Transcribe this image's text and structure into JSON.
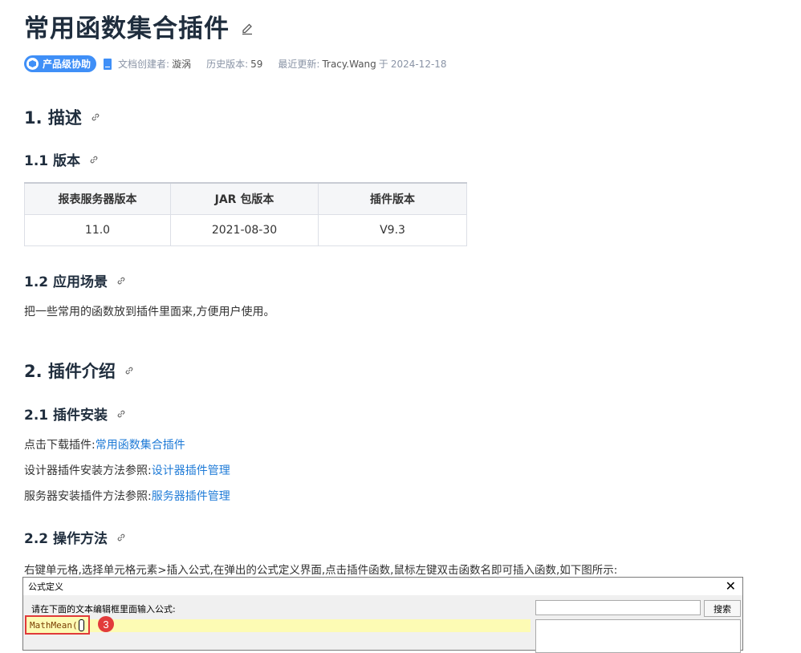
{
  "page": {
    "title": "常用函数集合插件"
  },
  "meta": {
    "badge": "产品级协助",
    "creator_label": "文档创建者:",
    "creator": "漩涡",
    "version_label": "历史版本:",
    "version": "59",
    "updated_label": "最近更新:",
    "updated_by": "Tracy.Wang",
    "updated_on_word": "于",
    "updated_date": "2024-12-18"
  },
  "sections": {
    "s1": "1. 描述",
    "s1_1": "1.1 版本",
    "s1_2": "1.2 应用场景",
    "s2": "2. 插件介绍",
    "s2_1": "2.1 插件安装",
    "s2_2": "2.2 操作方法"
  },
  "version_table": {
    "headers": [
      "报表服务器版本",
      "JAR 包版本",
      "插件版本"
    ],
    "row": [
      "11.0",
      "2021-08-30",
      "V9.3"
    ]
  },
  "scenario_text": "把一些常用的函数放到插件里面来,方便用户使用。",
  "install": {
    "download_prefix": "点击下载插件:",
    "download_link": "常用函数集合插件",
    "designer_prefix": "设计器插件安装方法参照:",
    "designer_link": "设计器插件管理",
    "server_prefix": "服务器安装插件方法参照:",
    "server_link": "服务器插件管理"
  },
  "usage_text": "右键单元格,选择单元格元素>插入公式,在弹出的公式定义界面,点击插件函数,鼠标左键双击函数名即可插入函数,如下图所示:",
  "dialog": {
    "title": "公式定义",
    "close": "✕",
    "prompt": "请在下面的文本编辑框里面输入公式:",
    "search_button": "搜索",
    "formula": "MathMean(",
    "step": "3"
  }
}
